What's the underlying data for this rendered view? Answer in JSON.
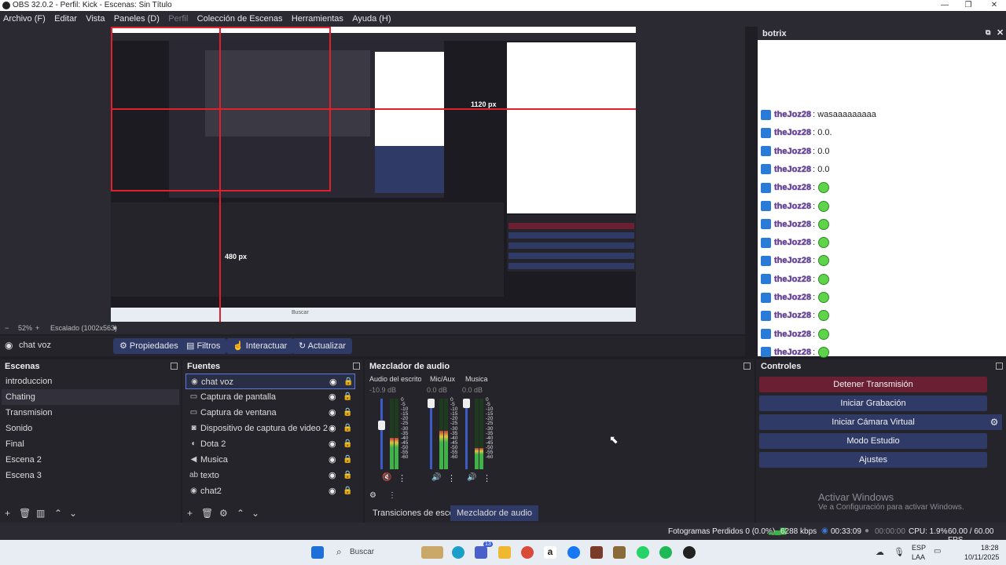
{
  "window": {
    "title": "OBS 32.0.2 - Perfil: Kick - Escenas: Sin Título"
  },
  "menubar": {
    "items": [
      "Archivo (F)",
      "Editar",
      "Vista",
      "Paneles (D)",
      "Perfil",
      "Colección de Escenas",
      "Herramientas",
      "Ayuda (H)"
    ]
  },
  "preview": {
    "zoom": "52%",
    "scale_label": "Escalado (1002x563)",
    "measure_h": "1120 px",
    "measure_v": "480 px",
    "inner_buscar": "Buscar"
  },
  "chat": {
    "title": "botrix",
    "messages": [
      {
        "user": "theJoz28",
        "text": ": wasaaaaaaaaa",
        "emote": false
      },
      {
        "user": "theJoz28",
        "text": ": 0.0.",
        "emote": false
      },
      {
        "user": "theJoz28",
        "text": ": 0.0",
        "emote": false
      },
      {
        "user": "theJoz28",
        "text": ": 0.0",
        "emote": false
      },
      {
        "user": "theJoz28",
        "text": ":",
        "emote": true
      },
      {
        "user": "theJoz28",
        "text": ":",
        "emote": true
      },
      {
        "user": "theJoz28",
        "text": ":",
        "emote": true
      },
      {
        "user": "theJoz28",
        "text": ":",
        "emote": true
      },
      {
        "user": "theJoz28",
        "text": ":",
        "emote": true
      },
      {
        "user": "theJoz28",
        "text": ":",
        "emote": true
      },
      {
        "user": "theJoz28",
        "text": ":",
        "emote": true
      },
      {
        "user": "theJoz28",
        "text": ":",
        "emote": true
      },
      {
        "user": "theJoz28",
        "text": ":",
        "emote": true
      },
      {
        "user": "theJoz28",
        "text": ":",
        "emote": true
      }
    ]
  },
  "source_bar": {
    "selected": "chat voz",
    "buttons": [
      "Propiedades",
      "Filtros",
      "Interactuar",
      "Actualizar"
    ]
  },
  "scenes": {
    "title": "Escenas",
    "items": [
      "introduccion",
      "Chating",
      "Transmision",
      "Sonido",
      "Final",
      "Escena 2",
      "Escena 3"
    ],
    "selected_index": 1
  },
  "sources": {
    "title": "Fuentes",
    "items": [
      {
        "label": "chat voz",
        "icon": "globe-icon"
      },
      {
        "label": "Captura de pantalla",
        "icon": "monitor-icon"
      },
      {
        "label": "Captura de ventana",
        "icon": "window-icon"
      },
      {
        "label": "Dispositivo de captura de video 2",
        "icon": "camera-icon"
      },
      {
        "label": "Dota 2",
        "icon": "gamepad-icon"
      },
      {
        "label": "Musica",
        "icon": "speaker-icon"
      },
      {
        "label": "texto",
        "icon": "text-icon"
      },
      {
        "label": "chat2",
        "icon": "globe-icon"
      }
    ]
  },
  "mixer": {
    "title": "Mezclador de audio",
    "channels": [
      {
        "name": "Audio del escritorio",
        "db": "-10.9 dB",
        "level": 0.45,
        "muted": true
      },
      {
        "name": "Mic/Aux",
        "db": "0.0 dB",
        "level": 0.55,
        "muted": false
      },
      {
        "name": "Musica",
        "db": "0.0 dB",
        "level": 0.3,
        "muted": false
      }
    ],
    "scale": [
      "0",
      "-5",
      "-10",
      "-15",
      "-20",
      "-25",
      "-30",
      "-35",
      "-40",
      "-45",
      "-50",
      "-55",
      "-60"
    ]
  },
  "tabs": {
    "items": [
      "Transiciones de escena",
      "Mezclador de audio"
    ],
    "active": 1
  },
  "controls": {
    "title": "Controles",
    "stop_stream": "Detener Transmisión",
    "start_record": "Iniciar Grabación",
    "start_vcam": "Iniciar Cámara Virtual",
    "studio_mode": "Modo Estudio",
    "settings": "Ajustes"
  },
  "watermark": {
    "line1": "Activar Windows",
    "line2": "Ve a Configuración para activar Windows."
  },
  "status": {
    "dropped": "Fotogramas Perdidos 0 (0.0%)",
    "bitrate": "6288 kbps",
    "live_time": "00:33:09",
    "rec_time": "00:00:00",
    "cpu": "CPU: 1.9%",
    "fps": "60.00 / 60.00 FPS"
  },
  "taskbar": {
    "search_placeholder": "Buscar",
    "lang1": "ESP",
    "lang2": "LAA",
    "time": "18:28",
    "date": "10/11/2025",
    "badge": "13"
  },
  "colors": {
    "accent": "#2f3a67",
    "stop": "#6b1f32",
    "panel": "#25242b"
  }
}
